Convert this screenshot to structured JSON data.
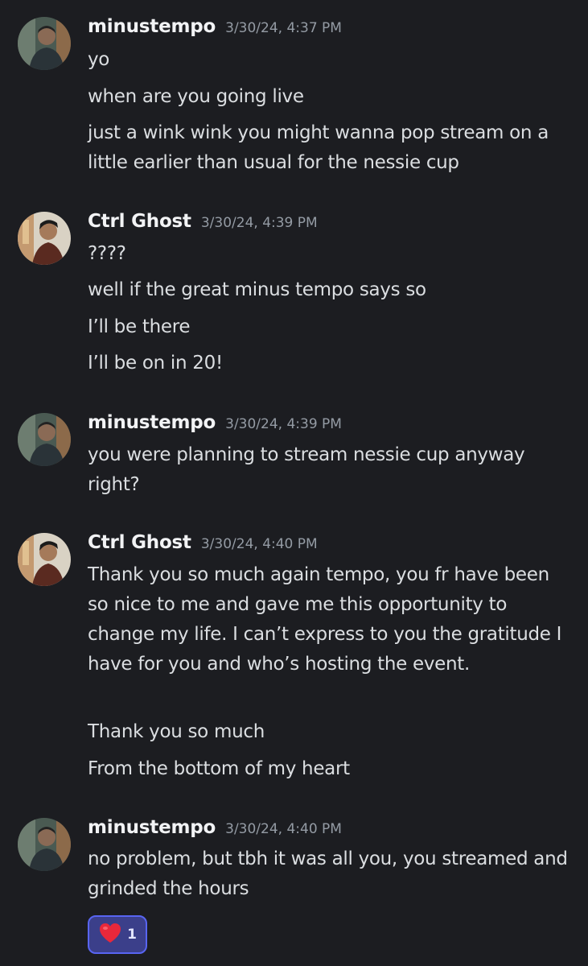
{
  "messages": [
    {
      "author": "minustempo",
      "timestamp": "3/30/24, 4:37 PM",
      "lines": [
        "yo",
        "when are you going live",
        "just a wink wink you might wanna pop stream on a little earlier than usual for the nessie cup"
      ]
    },
    {
      "author": "Ctrl Ghost",
      "timestamp": "3/30/24, 4:39 PM",
      "lines": [
        "????",
        "well if the great minus tempo says so",
        "I’ll be there",
        "I’ll be on in 20!"
      ]
    },
    {
      "author": "minustempo",
      "timestamp": "3/30/24, 4:39 PM",
      "lines": [
        "you were planning to stream nessie cup anyway right?"
      ]
    },
    {
      "author": "Ctrl Ghost",
      "timestamp": "3/30/24, 4:40 PM",
      "lines": [
        "Thank you so much again tempo, you fr have been so nice to me and gave me this opportunity to change my life. I can’t express to you the gratitude I have for you and who’s hosting the event.",
        "Thank you so much",
        "From the bottom of my heart"
      ]
    },
    {
      "author": "minustempo",
      "timestamp": "3/30/24, 4:40 PM",
      "lines": [
        "no problem, but tbh it was all you, you streamed and grinded the hours"
      ]
    }
  ],
  "reaction": {
    "emoji": "heart-emoji",
    "count": "1"
  },
  "colors": {
    "background": "#1c1d21",
    "author": "#f2f3f5",
    "timestamp": "#949ba4",
    "message_text": "#dbdee1",
    "reaction_border": "#5865f2",
    "reaction_bg": "#3b3f8a",
    "heart": "#e8283b"
  }
}
